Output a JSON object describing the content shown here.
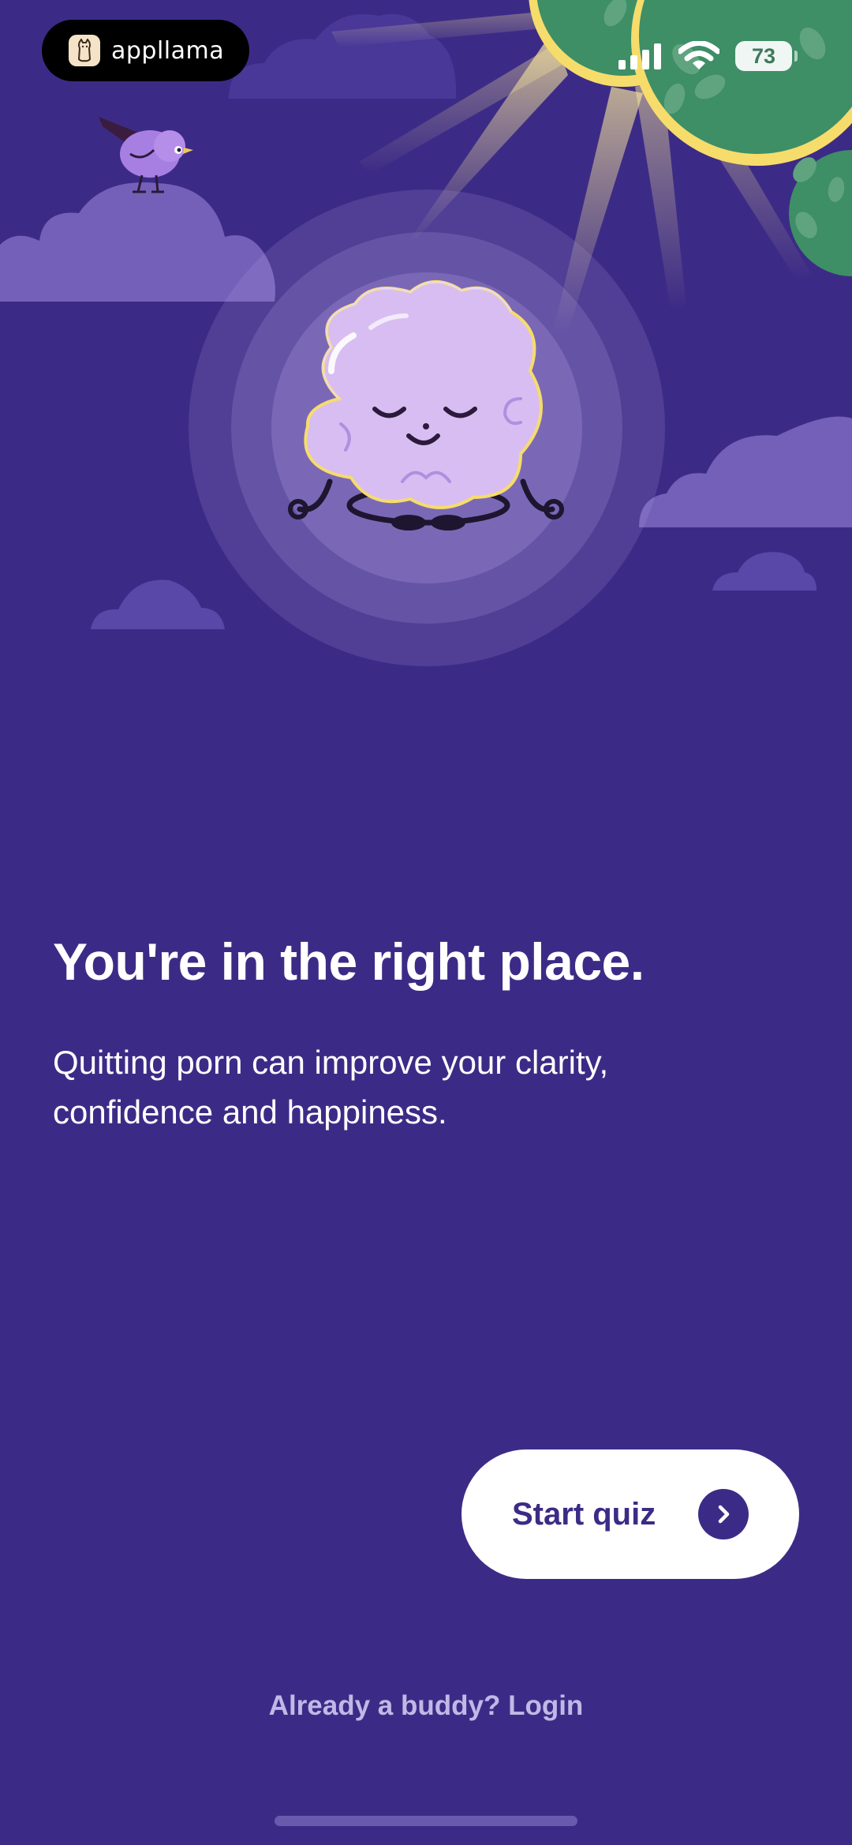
{
  "status_bar": {
    "app_pill_label": "appllama",
    "battery": "73"
  },
  "onboarding": {
    "headline": "You're in the right place.",
    "subtext": "Quitting porn can improve your clarity, confidence and happiness.",
    "start_button": "Start quiz",
    "login_link": "Already a buddy? Login"
  },
  "icons": {
    "logo": "llama-logo-icon",
    "signal": "cellular-signal-icon",
    "wifi": "wifi-icon",
    "arrow": "chevron-right-icon"
  },
  "colors": {
    "background": "#3c2b86",
    "cloud": "#7460b8",
    "sun_tree": "#3e8e66",
    "sun_rim": "#f6dc6b",
    "mascot": "#d8bdf2",
    "button": "#ffffff",
    "button_text": "#3c2b86",
    "link": "#c2b8e6"
  }
}
